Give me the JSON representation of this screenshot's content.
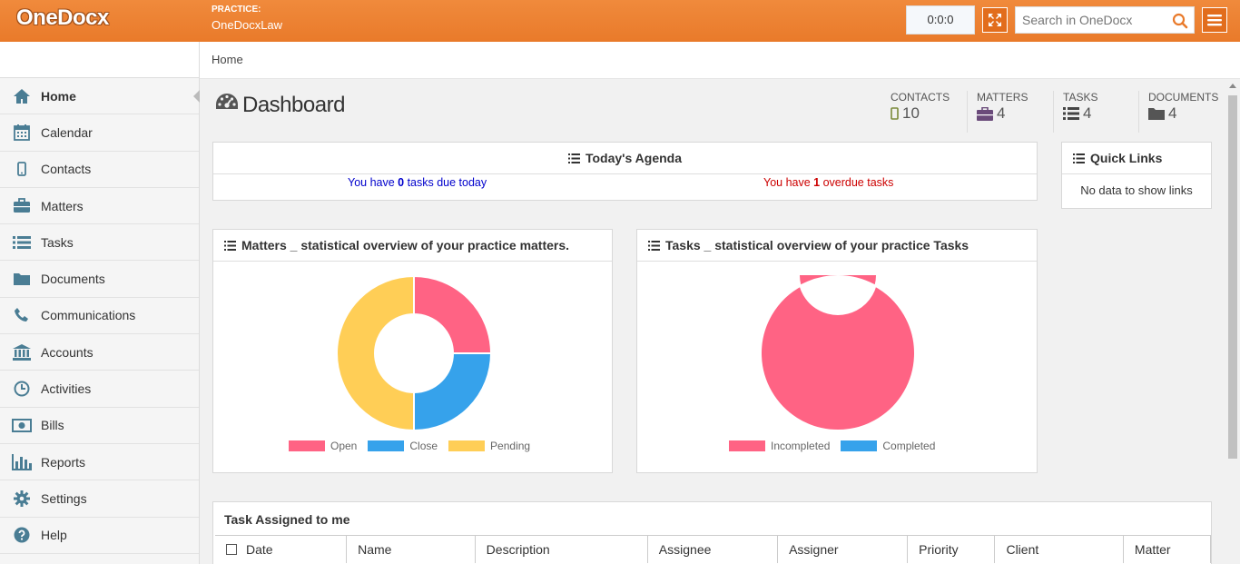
{
  "app": {
    "logo": "OneDocx",
    "practice_label": "PRACTICE:",
    "practice_name": "OneDocxLaw",
    "timer": "0:0:0",
    "search_placeholder": "Search in OneDocx"
  },
  "sidebar": {
    "items": [
      {
        "label": "Home",
        "icon": "home-icon"
      },
      {
        "label": "Calendar",
        "icon": "calendar-icon"
      },
      {
        "label": "Contacts",
        "icon": "mobile-icon"
      },
      {
        "label": "Matters",
        "icon": "briefcase-icon"
      },
      {
        "label": "Tasks",
        "icon": "list-icon"
      },
      {
        "label": "Documents",
        "icon": "folder-icon"
      },
      {
        "label": "Communications",
        "icon": "phone-icon"
      },
      {
        "label": "Accounts",
        "icon": "bank-icon"
      },
      {
        "label": "Activities",
        "icon": "clock-icon"
      },
      {
        "label": "Bills",
        "icon": "money-icon"
      },
      {
        "label": "Reports",
        "icon": "bar-chart-icon"
      },
      {
        "label": "Settings",
        "icon": "gear-icon"
      },
      {
        "label": "Help",
        "icon": "question-icon"
      }
    ],
    "active": "Home"
  },
  "breadcrumb": "Home",
  "dashboard": {
    "title": "Dashboard",
    "stats": [
      {
        "label": "CONTACTS",
        "value": "10",
        "icon": "mobile-icon"
      },
      {
        "label": "MATTERS",
        "value": "4",
        "icon": "briefcase-icon"
      },
      {
        "label": "TASKS",
        "value": "4",
        "icon": "list-icon"
      },
      {
        "label": "DOCUMENTS",
        "value": "4",
        "icon": "folder-icon"
      }
    ]
  },
  "agenda": {
    "title": "Today's Agenda",
    "due_prefix": "You have ",
    "due_count": "0",
    "due_suffix": " tasks due today",
    "overdue_prefix": "You have ",
    "overdue_count": "1",
    "overdue_suffix": " overdue tasks"
  },
  "quick_links": {
    "title": "Quick Links",
    "empty": "No data to show links"
  },
  "colors": {
    "accent": "#e97a2a",
    "pink": "#ff6384",
    "blue": "#36a2eb",
    "yellow": "#ffce56",
    "due_text": "#0000cc",
    "overdue_text": "#cc0000"
  },
  "chart_data": [
    {
      "type": "pie",
      "title": "Matters _ statistical overview of your practice matters.",
      "categories": [
        "Open",
        "Close",
        "Pending"
      ],
      "values": [
        1,
        1,
        2
      ],
      "colors": [
        "#ff6384",
        "#36a2eb",
        "#ffce56"
      ]
    },
    {
      "type": "pie",
      "title": "Tasks _ statistical overview of your practice Tasks",
      "categories": [
        "Incompleted",
        "Completed"
      ],
      "values": [
        4,
        0
      ],
      "colors": [
        "#ff6384",
        "#36a2eb"
      ]
    }
  ],
  "task_table": {
    "title": "Task Assigned to me",
    "columns": [
      "Date",
      "Name",
      "Description",
      "Assignee",
      "Assigner",
      "Priority",
      "Client",
      "Matter"
    ]
  }
}
